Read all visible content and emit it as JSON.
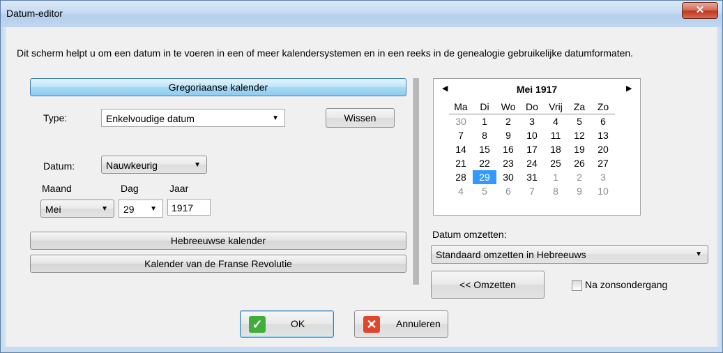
{
  "window": {
    "title": "Datum-editor",
    "close_label": "✕"
  },
  "intro": "Dit scherm helpt u om een datum in te voeren in een of meer kalendersystemen en in een reeks in de genealogie gebruikelijke datumformaten.",
  "gregorian": {
    "header": "Gregoriaanse kalender",
    "type_label": "Type:",
    "type_value": "Enkelvoudige datum",
    "clear_button": "Wissen",
    "datum_label": "Datum:",
    "datum_value": "Nauwkeurig",
    "month_label": "Maand",
    "day_label": "Dag",
    "year_label": "Jaar",
    "month_value": "Mei",
    "day_value": "29",
    "year_value": "1917"
  },
  "hebrew_button": "Hebreeuwse kalender",
  "french_button": "Kalender van de Franse Revolutie",
  "calendar": {
    "title": "Mei 1917",
    "weekdays": [
      "Ma",
      "Di",
      "Wo",
      "Do",
      "Vrij",
      "Za",
      "Zo"
    ],
    "weeks": [
      [
        "30",
        "1",
        "2",
        "3",
        "4",
        "5",
        "6"
      ],
      [
        "7",
        "8",
        "9",
        "10",
        "11",
        "12",
        "13"
      ],
      [
        "14",
        "15",
        "16",
        "17",
        "18",
        "19",
        "20"
      ],
      [
        "21",
        "22",
        "23",
        "24",
        "25",
        "26",
        "27"
      ],
      [
        "28",
        "29",
        "30",
        "31",
        "1",
        "2",
        "3"
      ],
      [
        "4",
        "5",
        "6",
        "7",
        "8",
        "9",
        "10"
      ]
    ],
    "selected": "29",
    "selected_color": "#3399ff"
  },
  "convert": {
    "label": "Datum omzetten:",
    "value": "Standaard omzetten in Hebreeuws",
    "button": "<< Omzetten",
    "checkbox_label": "Na zonsondergang",
    "checkbox_checked": false
  },
  "footer": {
    "ok": "OK",
    "cancel": "Annuleren"
  },
  "colors": {
    "ok_icon": "#3fae3a",
    "cancel_icon": "#e0462c",
    "active_tab": "#a7d9f5"
  }
}
